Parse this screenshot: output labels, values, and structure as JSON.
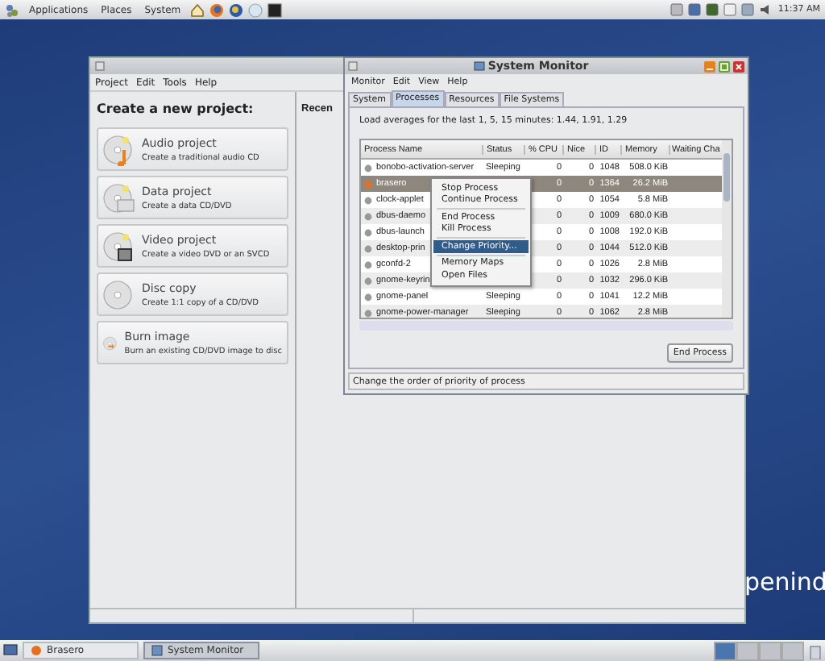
{
  "top_panel": {
    "menus": [
      "Applications",
      "Places",
      "System"
    ],
    "clock": "11:37 AM"
  },
  "wallpaper": {
    "logo_text": "penind"
  },
  "brasero": {
    "menus": [
      "Project",
      "Edit",
      "Tools",
      "Help"
    ],
    "heading": "Create a new project:",
    "recent_heading": "Recen",
    "projects": [
      {
        "kind": "audio",
        "title": "Audio project",
        "description": "Create a traditional audio CD"
      },
      {
        "kind": "data",
        "title": "Data project",
        "description": "Create a data CD/DVD"
      },
      {
        "kind": "video",
        "title": "Video project",
        "description": "Create a video DVD or an SVCD"
      },
      {
        "kind": "copy",
        "title": "Disc copy",
        "description": "Create 1:1 copy of a CD/DVD"
      },
      {
        "kind": "image",
        "title": "Burn image",
        "description": "Burn an existing CD/DVD image to disc"
      }
    ]
  },
  "system_monitor": {
    "title": "System Monitor",
    "menus": [
      "Monitor",
      "Edit",
      "View",
      "Help"
    ],
    "tabs": [
      {
        "label": "System",
        "selected": false
      },
      {
        "label": "Processes",
        "selected": true
      },
      {
        "label": "Resources",
        "selected": false
      },
      {
        "label": "File Systems",
        "selected": false
      }
    ],
    "load_text": "Load averages for the last 1, 5, 15 minutes: 1.44, 1.91, 1.29",
    "columns": [
      "Process Name",
      "Status",
      "% CPU",
      "Nice",
      "ID",
      "Memory",
      "Waiting Cha"
    ],
    "rows": [
      {
        "cells": [
          "bonobo-activation-server",
          "Sleeping",
          "0",
          "0",
          "1048",
          "508.0 KiB"
        ],
        "selected": false
      },
      {
        "cells": [
          "brasero",
          "",
          "0",
          "0",
          "1364",
          "26.2 MiB"
        ],
        "selected": true
      },
      {
        "cells": [
          "clock-applet",
          "",
          "0",
          "0",
          "1054",
          "5.8 MiB"
        ],
        "selected": false
      },
      {
        "cells": [
          "dbus-daemo",
          "",
          "0",
          "0",
          "1009",
          "680.0 KiB"
        ],
        "selected": false
      },
      {
        "cells": [
          "dbus-launch",
          "",
          "0",
          "0",
          "1008",
          "192.0 KiB"
        ],
        "selected": false
      },
      {
        "cells": [
          "desktop-prin",
          "",
          "0",
          "0",
          "1044",
          "512.0 KiB"
        ],
        "selected": false
      },
      {
        "cells": [
          "gconfd-2",
          "",
          "0",
          "0",
          "1026",
          "2.8 MiB"
        ],
        "selected": false
      },
      {
        "cells": [
          "gnome-keyrin",
          "",
          "0",
          "0",
          "1032",
          "296.0 KiB"
        ],
        "selected": false
      },
      {
        "cells": [
          "gnome-panel",
          "Sleeping",
          "0",
          "0",
          "1041",
          "12.2 MiB"
        ],
        "selected": false
      },
      {
        "cells": [
          "gnome-power-manager",
          "Sleeping",
          "0",
          "0",
          "1062",
          "2.8 MiB"
        ],
        "selected": false
      }
    ],
    "context_menu": [
      {
        "kind": "item",
        "label": "Stop Process",
        "selected": false
      },
      {
        "kind": "item",
        "label": "Continue Process",
        "selected": false
      },
      {
        "kind": "separator"
      },
      {
        "kind": "item",
        "label": "End Process",
        "selected": false
      },
      {
        "kind": "item",
        "label": "Kill Process",
        "selected": false
      },
      {
        "kind": "separator"
      },
      {
        "kind": "item",
        "label": "Change Priority...",
        "selected": true
      },
      {
        "kind": "separator"
      },
      {
        "kind": "item",
        "label": "Memory Maps",
        "selected": false
      },
      {
        "kind": "item",
        "label": "Open Files",
        "selected": false
      }
    ],
    "end_button": "End Process",
    "status_bar": "Change the order of priority of process"
  },
  "taskbar": {
    "tasks": [
      {
        "label": "Brasero",
        "selected": false
      },
      {
        "label": "System Monitor",
        "selected": true
      }
    ]
  }
}
